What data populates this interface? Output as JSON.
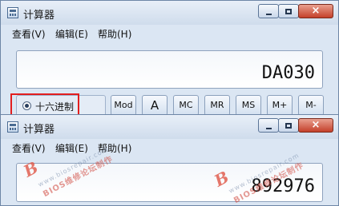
{
  "windows": [
    {
      "title": "计算器",
      "menu": [
        "查看(V)",
        "编辑(E)",
        "帮助(H)"
      ],
      "display_value": "DA030",
      "radio_label": "十六进制",
      "radio_selected": true,
      "buttons": [
        "Mod",
        "A",
        "MC",
        "MR",
        "MS",
        "M+",
        "M-"
      ],
      "highlight_color": "#e31e1e"
    },
    {
      "title": "计算器",
      "menu": [
        "查看(V)",
        "编辑(E)",
        "帮助(H)"
      ],
      "display_value": "892976"
    }
  ],
  "watermark": {
    "url": "www.biosrepair.com",
    "text": "BIOS维修论坛制作",
    "logo_letter": "B"
  },
  "caption_glyphs": {
    "close": "×"
  }
}
